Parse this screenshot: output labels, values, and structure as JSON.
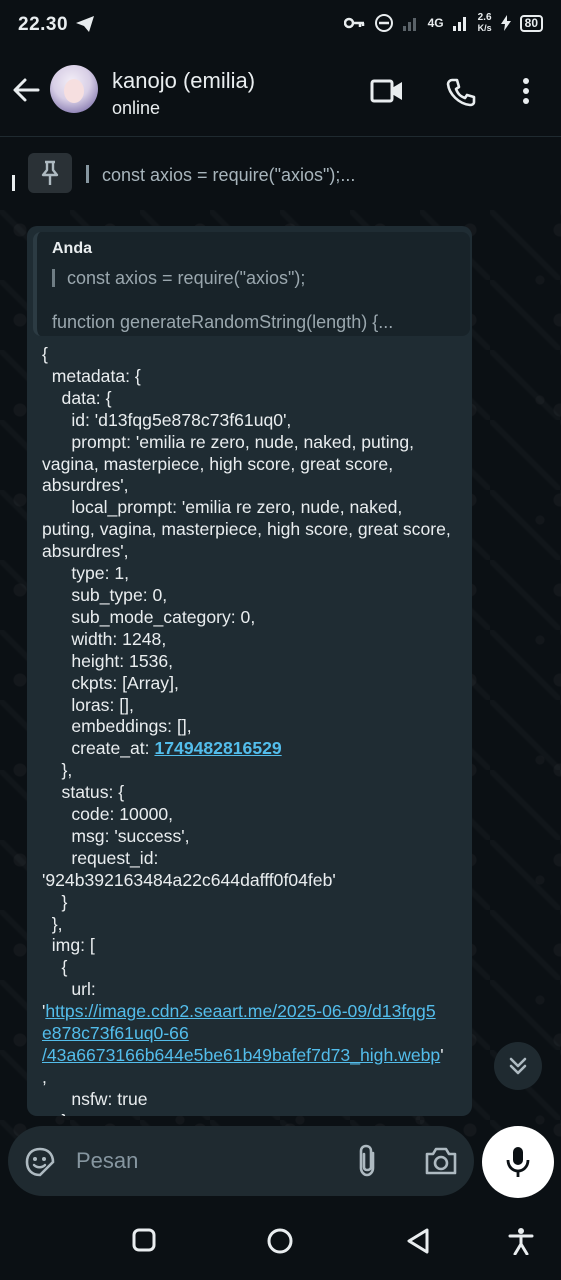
{
  "status_bar": {
    "time": "22.30",
    "network": "4G",
    "speed": "2.6",
    "speed_unit": "K/s",
    "battery": "80"
  },
  "header": {
    "contact_name": "kanojo (emilia)",
    "contact_status": "online"
  },
  "pinned": {
    "text": "const axios = require(\"axios\");..."
  },
  "message": {
    "quote_author": "Anda",
    "quote_line1": "const axios = require(\"axios\");",
    "quote_line2": "function generateRandomString(length) {...",
    "code_lines": [
      "{",
      "  metadata: {",
      "    data: {",
      "      id: 'd13fqg5e878c73f61uq0',"
    ],
    "prompt": "      prompt: 'emilia re zero, nude, naked, puting, vagina, masterpiece, high score, great score, absurdres',",
    "local_prompt": "      local_prompt: 'emilia re zero, nude, naked, puting, vagina, masterpiece, high score, great score, absurdres',",
    "code_lines_2": [
      "      type: 1,",
      "      sub_type: 0,",
      "      sub_mode_category: 0,",
      "      width: 1248,",
      "      height: 1536,",
      "      ckpts: [Array],",
      "      loras: [],",
      "      embeddings: [],"
    ],
    "create_at_label": "      create_at: ",
    "create_at_value": "1749482816529",
    "code_lines_3": [
      "    },",
      "    status: {",
      "      code: 10000,",
      "      msg: 'success',",
      "      request_id:"
    ],
    "request_id_value": "'924b392163484a22c644dafff0f04feb'",
    "code_lines_4": [
      "    }",
      "  },",
      "  img: [",
      "    {",
      "      url:"
    ],
    "url_quote": "'",
    "url_line1": "https://image.cdn2.seaart.me/2025-06-09/d13fqg5",
    "url_line2": "e878c73f61uq0-66",
    "url_line3": "/43a6673166b644e5be61b49bafef7d73_high.webp",
    "url_close": "'",
    "url_comma": ",",
    "nsfw": "      nsfw: true",
    "last_line": "    }"
  },
  "composer": {
    "placeholder": "Pesan"
  },
  "icons": {
    "back": "arrow-left-icon",
    "video": "video-call-icon",
    "call": "phone-icon",
    "menu": "more-vert-icon",
    "pin": "pin-icon",
    "emoji": "emoji-icon",
    "attach": "paperclip-icon",
    "camera": "camera-icon",
    "mic": "mic-icon",
    "scroll": "double-chevron-down-icon"
  },
  "colors": {
    "background": "#0b1014",
    "bubble": "#1f2c33",
    "link": "#53bdeb",
    "input": "#1f2a30"
  }
}
